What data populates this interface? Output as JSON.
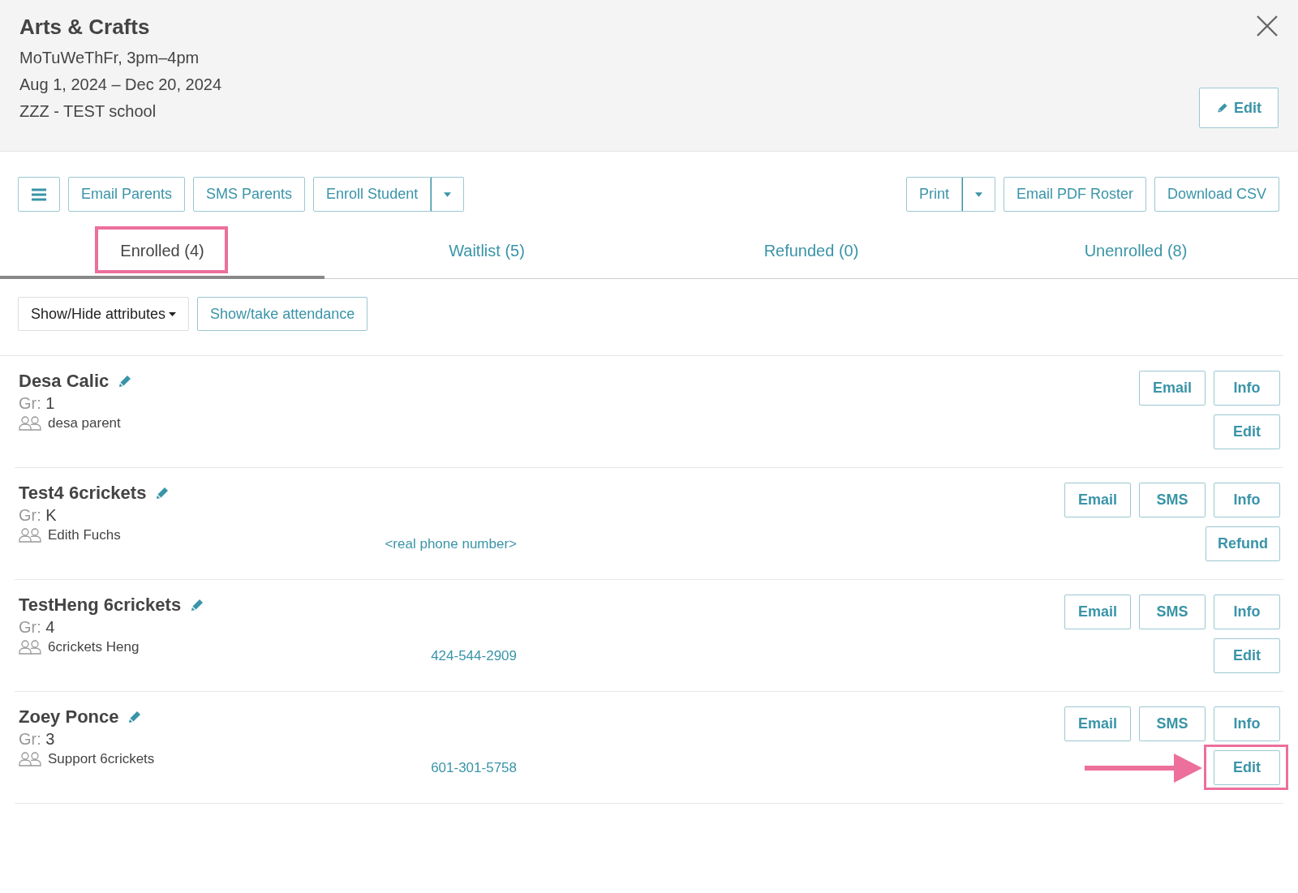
{
  "header": {
    "title": "Arts & Crafts",
    "lines": [
      "MoTuWeThFr, 3pm–4pm",
      "Aug 1, 2024 – Dec 20, 2024",
      "ZZZ - TEST school"
    ],
    "edit_button": "Edit"
  },
  "toolbar": {
    "left": [
      {
        "kind": "menu"
      },
      {
        "kind": "button",
        "label": "Email Parents"
      },
      {
        "kind": "button",
        "label": "SMS Parents"
      },
      {
        "kind": "split",
        "label": "Enroll Student"
      }
    ],
    "right": [
      {
        "kind": "split",
        "label": "Print"
      },
      {
        "kind": "button",
        "label": "Email PDF Roster"
      },
      {
        "kind": "button",
        "label": "Download CSV"
      }
    ]
  },
  "tabs": [
    {
      "label": "Enrolled (4)",
      "selected": true,
      "annotated": true
    },
    {
      "label": "Waitlist (5)",
      "selected": false,
      "annotated": false
    },
    {
      "label": "Refunded (0)",
      "selected": false,
      "annotated": false
    },
    {
      "label": "Unenrolled (8)",
      "selected": false,
      "annotated": false
    }
  ],
  "filters": [
    {
      "kind": "dropdown",
      "label": "Show/Hide attributes"
    },
    {
      "kind": "button",
      "label": "Show/take attendance"
    }
  ],
  "students": [
    {
      "name": "Desa Calic",
      "grade_label": "Gr:",
      "grade": "1",
      "parent": "desa parent",
      "actions": [
        [
          {
            "label": "Email",
            "annotated": false
          },
          {
            "label": "Info",
            "annotated": false
          }
        ],
        [
          {
            "label": "Edit",
            "annotated": false
          }
        ]
      ]
    },
    {
      "name": "Test4 6crickets",
      "grade_label": "Gr:",
      "grade": "K",
      "parent": "Edith Fuchs",
      "phone": "<real phone number>",
      "actions": [
        [
          {
            "label": "Email",
            "annotated": false
          },
          {
            "label": "SMS",
            "annotated": false
          },
          {
            "label": "Info",
            "annotated": false
          }
        ],
        [
          {
            "label": "Refund",
            "annotated": false
          }
        ]
      ]
    },
    {
      "name": "TestHeng 6crickets",
      "grade_label": "Gr:",
      "grade": "4",
      "parent": "6crickets Heng",
      "phone": "424-544-2909",
      "actions": [
        [
          {
            "label": "Email",
            "annotated": false
          },
          {
            "label": "SMS",
            "annotated": false
          },
          {
            "label": "Info",
            "annotated": false
          }
        ],
        [
          {
            "label": "Edit",
            "annotated": false
          }
        ]
      ]
    },
    {
      "name": "Zoey Ponce",
      "grade_label": "Gr:",
      "grade": "3",
      "parent": "Support 6crickets",
      "phone": "601-301-5758",
      "actions": [
        [
          {
            "label": "Email",
            "annotated": false
          },
          {
            "label": "SMS",
            "annotated": false
          },
          {
            "label": "Info",
            "annotated": false
          }
        ],
        [
          {
            "label": "Edit",
            "annotated": true
          }
        ]
      ]
    }
  ]
}
